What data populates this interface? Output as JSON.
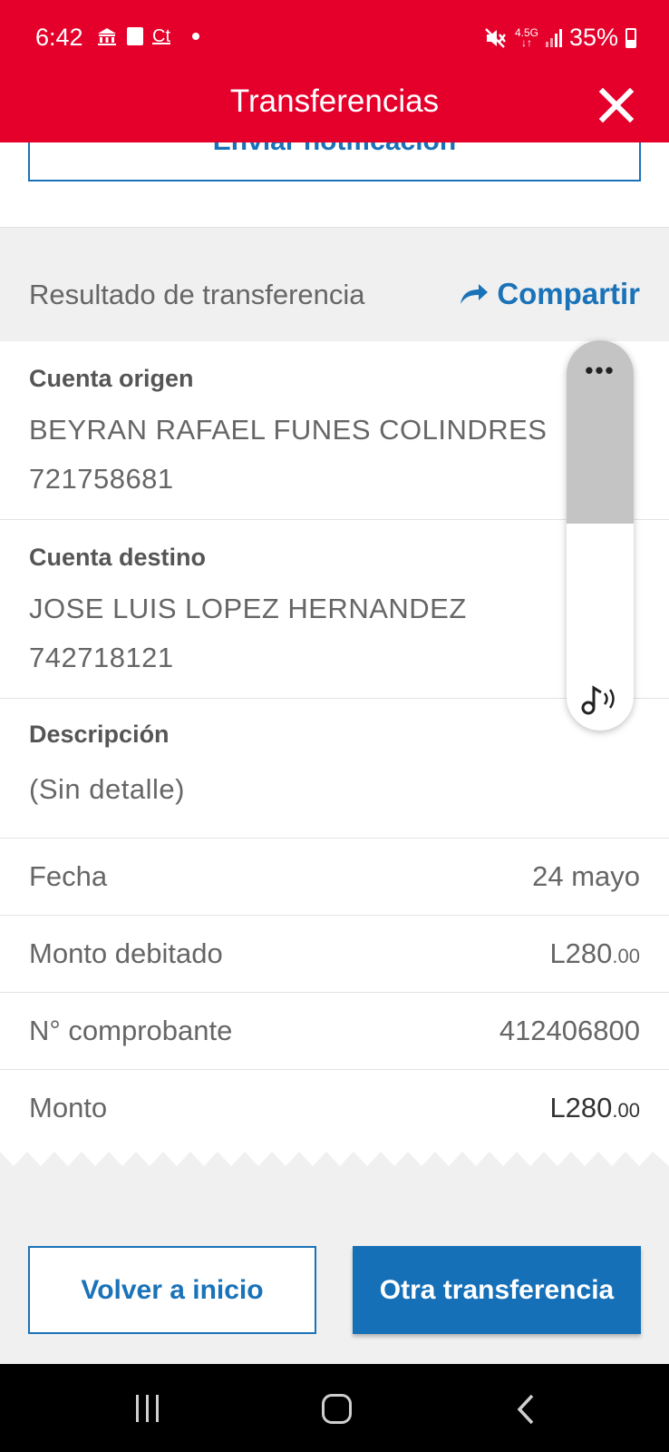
{
  "status_bar": {
    "time": "6:42",
    "carrier_text": "Ct",
    "network": "4.5G",
    "battery": "35%"
  },
  "header": {
    "title": "Transferencias",
    "background_color": "#e4002b",
    "close_icon": "close-icon"
  },
  "notify_button": {
    "label": "Enviar notificación"
  },
  "result": {
    "title": "Resultado de transferencia",
    "share_label": "Compartir",
    "share_icon": "share-arrow-icon",
    "accent_color": "#1a73b8"
  },
  "origin": {
    "label": "Cuenta origen",
    "name": "BEYRAN RAFAEL FUNES COLINDRES",
    "account": "721758681"
  },
  "destination": {
    "label": "Cuenta destino",
    "name": "JOSE LUIS LOPEZ HERNANDEZ",
    "account": "742718121"
  },
  "description": {
    "label": "Descripción",
    "value": "(Sin detalle)"
  },
  "details": {
    "date": {
      "label": "Fecha",
      "value": "24 mayo"
    },
    "debited": {
      "label": "Monto debitado",
      "value": "L280",
      "cents": ".00"
    },
    "receipt": {
      "label": "N° comprobante",
      "value": "412406800"
    },
    "amount": {
      "label": "Monto",
      "value": "L280",
      "cents": ".00"
    }
  },
  "actions": {
    "home_label": "Volver a inicio",
    "other_label": "Otra transferencia"
  },
  "volume_panel": {
    "menu_label": "•••",
    "level": 0.47,
    "icon": "media-volume-icon"
  },
  "nav_bar": {
    "icons": [
      "recents-icon",
      "home-icon",
      "back-icon"
    ]
  }
}
